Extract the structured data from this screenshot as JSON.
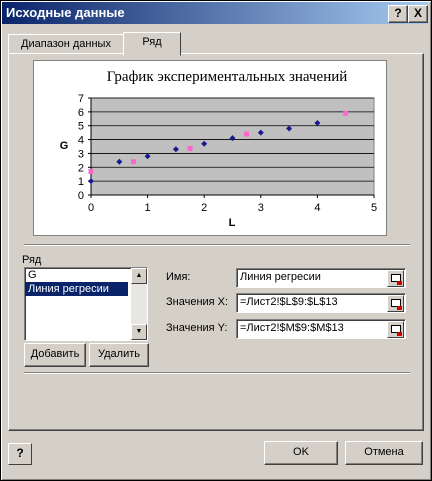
{
  "window": {
    "title": "Исходные данные"
  },
  "titlebar": {
    "help_glyph": "?",
    "close_glyph": "X"
  },
  "tabs": [
    {
      "label": "Диапазон данных"
    },
    {
      "label": "Ряд"
    }
  ],
  "chart_data": {
    "type": "scatter",
    "title": "График экспериментальных значений",
    "xlabel": "L",
    "ylabel": "G",
    "xlim": [
      0,
      5
    ],
    "ylim": [
      0,
      7
    ],
    "x_ticks": [
      "0",
      "1",
      "2",
      "3",
      "4",
      "5"
    ],
    "y_ticks": [
      "0",
      "1",
      "2",
      "3",
      "4",
      "5",
      "6",
      "7"
    ],
    "grid": "horizontal",
    "series": [
      {
        "name": "G",
        "color": "#1a1a8c",
        "x": [
          0,
          0.5,
          1,
          1.5,
          2,
          2.5,
          3,
          3.5,
          4
        ],
        "y": [
          1.0,
          2.4,
          2.8,
          3.3,
          3.7,
          4.1,
          4.5,
          4.8,
          5.2
        ]
      },
      {
        "name": "Линия регресии",
        "color": "#ff66cc",
        "x": [
          0,
          0.75,
          1.75,
          2.75,
          4.5
        ],
        "y": [
          1.7,
          2.4,
          3.35,
          4.4,
          5.9
        ]
      }
    ]
  },
  "series_group": {
    "label": "Ряд",
    "items": [
      "G",
      "Линия регресии"
    ],
    "selected": 1
  },
  "buttons": {
    "add": "Добавить",
    "delete": "Удалить",
    "ok": "OK",
    "cancel": "Отмена"
  },
  "fields": {
    "name_label": "Имя:",
    "name_value": "Линия регресии",
    "x_label": "Значения X:",
    "x_value": "=Лист2!$L$9:$L$13",
    "y_label": "Значения Y:",
    "y_value": "=Лист2!$M$9:$M$13"
  }
}
